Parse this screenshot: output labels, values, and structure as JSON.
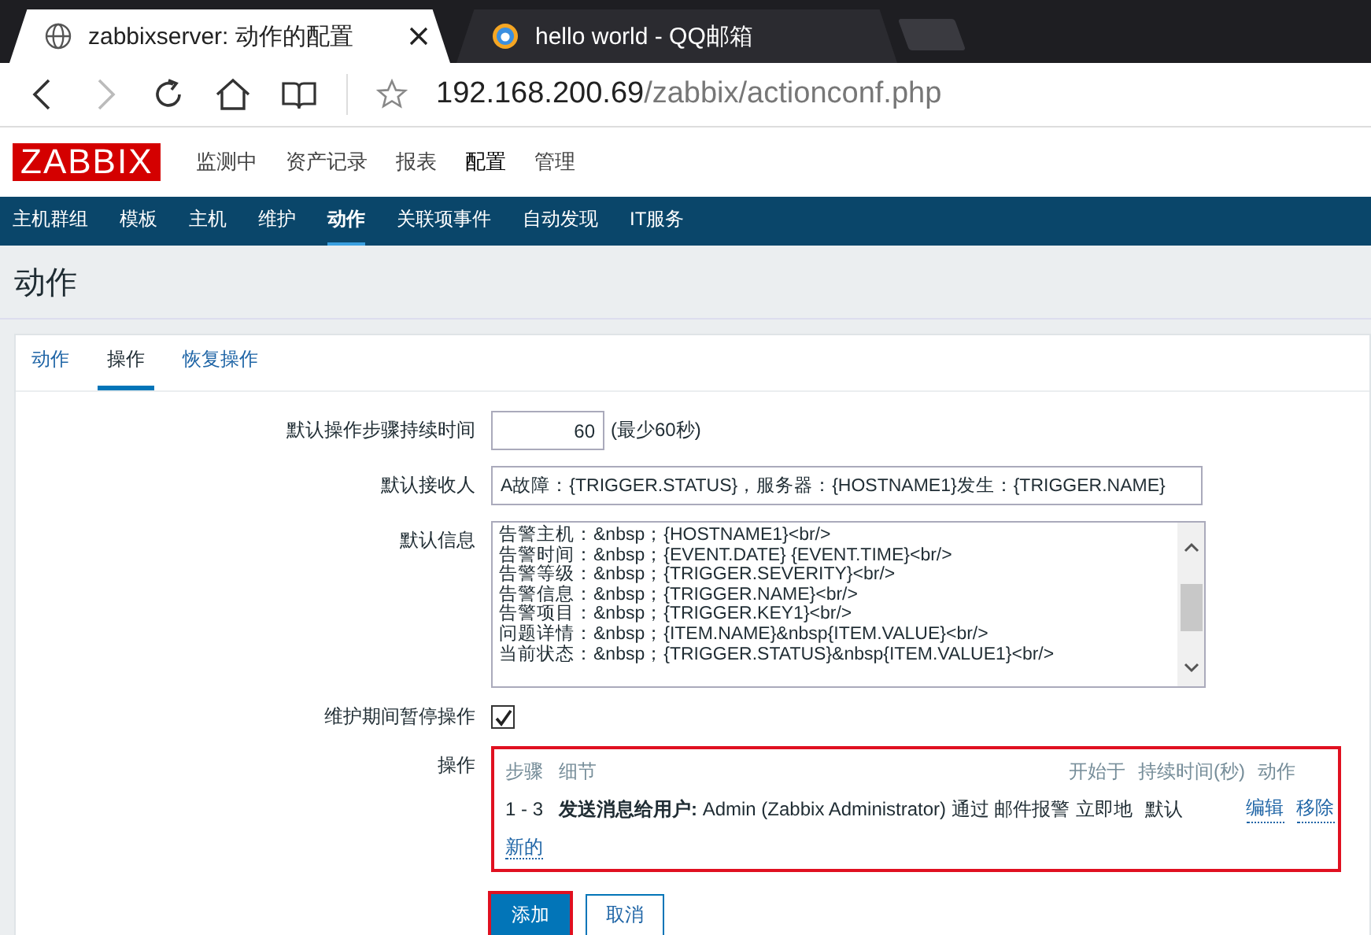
{
  "browser": {
    "tabs": [
      {
        "title": "zabbixserver: 动作的配置",
        "selected": true
      },
      {
        "title": "hello world - QQ邮箱",
        "selected": false
      }
    ],
    "nav_buttons": [
      {
        "kind": "back",
        "disabled": false
      },
      {
        "kind": "forward",
        "disabled": true
      },
      {
        "kind": "reload",
        "disabled": false
      },
      {
        "kind": "home",
        "disabled": false
      },
      {
        "kind": "reading",
        "disabled": false
      }
    ],
    "url": {
      "host": "192.168.200.69",
      "path": "/zabbix/actionconf.php"
    }
  },
  "header": {
    "logo": "ZABBIX",
    "menu": [
      {
        "label": "监测中",
        "selected": false
      },
      {
        "label": "资产记录",
        "selected": false
      },
      {
        "label": "报表",
        "selected": false
      },
      {
        "label": "配置",
        "selected": true
      },
      {
        "label": "管理",
        "selected": false
      }
    ]
  },
  "subnav": [
    {
      "label": "主机群组",
      "selected": false
    },
    {
      "label": "模板",
      "selected": false
    },
    {
      "label": "主机",
      "selected": false
    },
    {
      "label": "维护",
      "selected": false
    },
    {
      "label": "动作",
      "selected": true
    },
    {
      "label": "关联项事件",
      "selected": false
    },
    {
      "label": "自动发现",
      "selected": false
    },
    {
      "label": "IT服务",
      "selected": false
    }
  ],
  "page_title": "动作",
  "form_tabs": [
    {
      "label": "动作",
      "selected": false
    },
    {
      "label": "操作",
      "selected": true
    },
    {
      "label": "恢复操作",
      "selected": false
    }
  ],
  "step_duration": {
    "label": "默认操作步骤持续时间",
    "value": "60",
    "hint": "(最少60秒)"
  },
  "recipient": {
    "label": "默认接收人",
    "value": "A故障：{TRIGGER.STATUS}，服务器：{HOSTNAME1}发生：{TRIGGER.NAME}"
  },
  "message": {
    "label": "默认信息",
    "lines": [
      "告警主机：&nbsp；{HOSTNAME1}<br/>",
      "告警时间：&nbsp；{EVENT.DATE} {EVENT.TIME}<br/>",
      "告警等级：&nbsp；{TRIGGER.SEVERITY}<br/>",
      "告警信息：&nbsp；{TRIGGER.NAME}<br/>",
      "告警项目：&nbsp；{TRIGGER.KEY1}<br/>",
      "问题详情：&nbsp；{ITEM.NAME}&nbsp{ITEM.VALUE}<br/>",
      "当前状态：&nbsp；{TRIGGER.STATUS}&nbsp{ITEM.VALUE1}<br/>"
    ]
  },
  "pause": {
    "label": "维护期间暂停操作",
    "checked": true
  },
  "operations": {
    "label": "操作",
    "columns": [
      "步骤",
      "细节",
      "开始于",
      "持续时间(秒)",
      "动作"
    ],
    "rows": [
      {
        "steps": "1 - 3",
        "detail": "**发送消息给用户:** Admin (Zabbix Administrator) 通过 邮件报警",
        "start": "立即地",
        "duration": "默认",
        "actions": [
          "编辑",
          "移除"
        ]
      }
    ],
    "new_link": "新的"
  },
  "buttons": [
    {
      "label": "添加",
      "kind": "primary"
    },
    {
      "label": "取消",
      "kind": "secondary"
    }
  ]
}
